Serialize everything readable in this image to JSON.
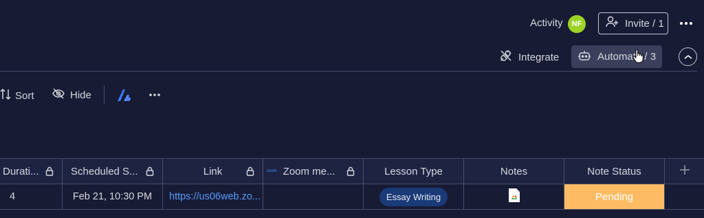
{
  "header": {
    "activity_label": "Activity",
    "avatar_initials": "NF",
    "invite_label": "Invite / 1"
  },
  "actions": {
    "integrate_label": "Integrate",
    "automate_label": "Automate / 3"
  },
  "toolbar": {
    "sort_label": "Sort",
    "hide_label": "Hide"
  },
  "table": {
    "columns": [
      {
        "label": "Durati..."
      },
      {
        "label": "Scheduled S..."
      },
      {
        "label": "Link"
      },
      {
        "label": "Zoom me...",
        "icon_text": "zoom"
      },
      {
        "label": "Lesson Type"
      },
      {
        "label": "Notes"
      },
      {
        "label": "Note Status"
      }
    ],
    "rows": [
      {
        "duration": "4",
        "scheduled": "Feb 21, 10:30 PM",
        "link": "https://us06web.zo...",
        "zoom": "",
        "lesson_type": "Essay Writing",
        "notes_icon": "document-file-icon",
        "note_status": "Pending"
      }
    ]
  },
  "colors": {
    "background": "#181b34",
    "pending": "#fdbc64",
    "lesson_pill": "#1a3a78",
    "link": "#579bfc",
    "avatar": "#9cd326"
  }
}
